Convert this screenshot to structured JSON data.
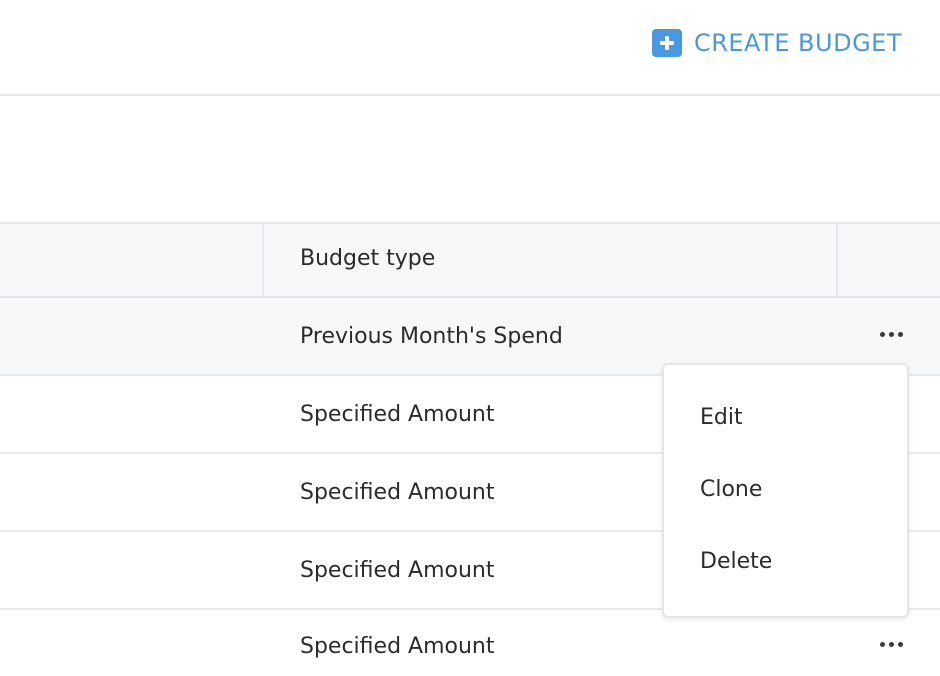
{
  "toolbar": {
    "create_label": "CREATE BUDGET",
    "create_icon": "plus-icon",
    "accent_color": "#4a98e0"
  },
  "table": {
    "columns": [
      "Budget type"
    ],
    "rows": [
      {
        "budget_type": "Previous Month's Spend",
        "has_actions": true
      },
      {
        "budget_type": "Specified Amount",
        "has_actions": false
      },
      {
        "budget_type": "Specified Amount",
        "has_actions": false
      },
      {
        "budget_type": "Specified Amount",
        "has_actions": false
      },
      {
        "budget_type": "Specified Amount",
        "has_actions": true
      }
    ],
    "actions_icon": "more-horizontal-icon"
  },
  "menu": {
    "items": [
      "Edit",
      "Clone",
      "Delete"
    ]
  }
}
